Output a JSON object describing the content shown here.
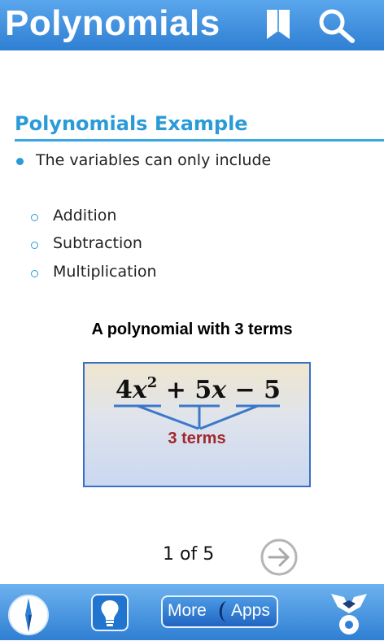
{
  "header": {
    "title": "Polynomials",
    "bookmark_icon": "bookmark-icon",
    "search_icon": "search-icon"
  },
  "content": {
    "section_title": "Polynomials Example",
    "bullet": "The variables can only include",
    "sub_items": [
      "Addition",
      "Subtraction",
      "Multiplication"
    ],
    "figure_caption": "A polynomial with 3 terms",
    "figure": {
      "expression_parts": [
        "4",
        "x",
        "2",
        " + 5",
        "x",
        " − 5"
      ],
      "terms_label": "3 terms"
    }
  },
  "pager": {
    "text": "1 of 5",
    "next_icon": "arrow-right-circle-icon"
  },
  "bottom_bar": {
    "compass_icon": "compass-icon",
    "bulb_icon": "lightbulb-icon",
    "more_label": "More",
    "apps_label": "Apps",
    "mascot_icon": "mascot-icon"
  },
  "colors": {
    "header_blue": "#2f7fd3",
    "accent": "#2b9bd8",
    "terms_red": "#a0282d",
    "bracket_blue": "#3b78c8"
  }
}
